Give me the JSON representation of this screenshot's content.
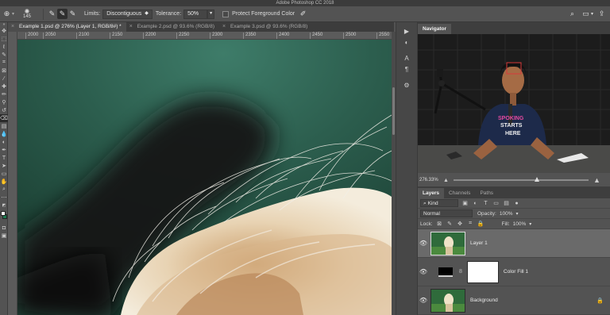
{
  "app": {
    "title": "Adobe Photoshop CC 2018"
  },
  "options": {
    "brush_size": "145",
    "limits_label": "Limits:",
    "limits_value": "Discontiguous",
    "tolerance_label": "Tolerance:",
    "tolerance_value": "50%",
    "protect_label": "Protect Foreground Color"
  },
  "tabs": [
    {
      "label": "Example 1.psd @ 276% (Layer 1, RGB/8#) *",
      "active": true
    },
    {
      "label": "Example 2.psd @ 93.6% (RGB/8)",
      "active": false
    },
    {
      "label": "Example 3.psd @ 93.6% (RGB/8)",
      "active": false
    }
  ],
  "ruler": {
    "ticks": [
      "2000",
      "2050",
      "2100",
      "2150",
      "2200",
      "2250",
      "2300",
      "2350",
      "2400",
      "2450",
      "2500",
      "2550"
    ]
  },
  "navigator": {
    "tab": "Navigator",
    "zoom": "276.33%",
    "zoom_fraction": 0.62,
    "shirt_text": [
      "SPOKING",
      "STARTS",
      "HERE"
    ]
  },
  "layers_panel": {
    "tabs": [
      "Layers",
      "Channels",
      "Paths"
    ],
    "kind": "Kind",
    "blend_mode": "Normal",
    "opacity_label": "Opacity:",
    "opacity_value": "100%",
    "lock_label": "Lock:",
    "fill_label": "Fill:",
    "fill_value": "100%",
    "layers": [
      {
        "name": "Layer 1",
        "selected": true
      },
      {
        "name": "Color Fill 1",
        "selected": false
      },
      {
        "name": "Background",
        "selected": false
      }
    ]
  },
  "colors": {
    "canvas_bg": "#2d5c4e",
    "panel": "#535353",
    "selected_layer": "#6a6a6a"
  }
}
